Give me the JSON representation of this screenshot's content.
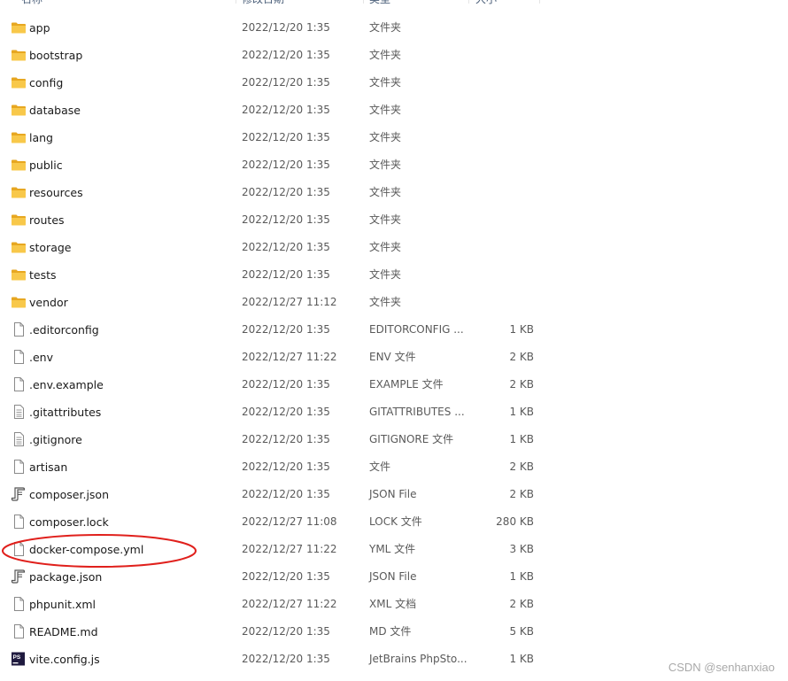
{
  "header": {
    "name": "名称",
    "date": "修改日期",
    "type": "类型",
    "size": "大小"
  },
  "rows": [
    {
      "name": "app",
      "date": "2022/12/20 1:35",
      "type": "文件夹",
      "size": "",
      "icon": "folder-icon"
    },
    {
      "name": "bootstrap",
      "date": "2022/12/20 1:35",
      "type": "文件夹",
      "size": "",
      "icon": "folder-icon"
    },
    {
      "name": "config",
      "date": "2022/12/20 1:35",
      "type": "文件夹",
      "size": "",
      "icon": "folder-icon"
    },
    {
      "name": "database",
      "date": "2022/12/20 1:35",
      "type": "文件夹",
      "size": "",
      "icon": "folder-icon"
    },
    {
      "name": "lang",
      "date": "2022/12/20 1:35",
      "type": "文件夹",
      "size": "",
      "icon": "folder-icon"
    },
    {
      "name": "public",
      "date": "2022/12/20 1:35",
      "type": "文件夹",
      "size": "",
      "icon": "folder-icon"
    },
    {
      "name": "resources",
      "date": "2022/12/20 1:35",
      "type": "文件夹",
      "size": "",
      "icon": "folder-icon"
    },
    {
      "name": "routes",
      "date": "2022/12/20 1:35",
      "type": "文件夹",
      "size": "",
      "icon": "folder-icon"
    },
    {
      "name": "storage",
      "date": "2022/12/20 1:35",
      "type": "文件夹",
      "size": "",
      "icon": "folder-icon"
    },
    {
      "name": "tests",
      "date": "2022/12/20 1:35",
      "type": "文件夹",
      "size": "",
      "icon": "folder-icon"
    },
    {
      "name": "vendor",
      "date": "2022/12/27 11:12",
      "type": "文件夹",
      "size": "",
      "icon": "folder-icon"
    },
    {
      "name": ".editorconfig",
      "date": "2022/12/20 1:35",
      "type": "EDITORCONFIG ...",
      "size": "1 KB",
      "icon": "file-icon"
    },
    {
      "name": ".env",
      "date": "2022/12/27 11:22",
      "type": "ENV 文件",
      "size": "2 KB",
      "icon": "file-icon"
    },
    {
      "name": ".env.example",
      "date": "2022/12/20 1:35",
      "type": "EXAMPLE 文件",
      "size": "2 KB",
      "icon": "file-icon"
    },
    {
      "name": ".gitattributes",
      "date": "2022/12/20 1:35",
      "type": "GITATTRIBUTES ...",
      "size": "1 KB",
      "icon": "text-file-icon"
    },
    {
      "name": ".gitignore",
      "date": "2022/12/20 1:35",
      "type": "GITIGNORE 文件",
      "size": "1 KB",
      "icon": "text-file-icon"
    },
    {
      "name": "artisan",
      "date": "2022/12/20 1:35",
      "type": "文件",
      "size": "2 KB",
      "icon": "file-icon"
    },
    {
      "name": "composer.json",
      "date": "2022/12/20 1:35",
      "type": "JSON File",
      "size": "2 KB",
      "icon": "json-script-icon"
    },
    {
      "name": "composer.lock",
      "date": "2022/12/27 11:08",
      "type": "LOCK 文件",
      "size": "280 KB",
      "icon": "file-icon"
    },
    {
      "name": "docker-compose.yml",
      "date": "2022/12/27 11:22",
      "type": "YML 文件",
      "size": "3 KB",
      "icon": "file-icon"
    },
    {
      "name": "package.json",
      "date": "2022/12/20 1:35",
      "type": "JSON File",
      "size": "1 KB",
      "icon": "json-script-icon"
    },
    {
      "name": "phpunit.xml",
      "date": "2022/12/27 11:22",
      "type": "XML 文档",
      "size": "2 KB",
      "icon": "file-icon"
    },
    {
      "name": "README.md",
      "date": "2022/12/20 1:35",
      "type": "MD 文件",
      "size": "5 KB",
      "icon": "file-icon"
    },
    {
      "name": "vite.config.js",
      "date": "2022/12/20 1:35",
      "type": "JetBrains PhpSto...",
      "size": "1 KB",
      "icon": "phpstorm-icon"
    }
  ],
  "watermark": "CSDN @senhanxiao",
  "colors": {
    "folder": "#f8c84a",
    "folder_dark": "#e7a721",
    "annotation": "#e0201c",
    "phpstorm_bg": "#1f1a3f"
  }
}
